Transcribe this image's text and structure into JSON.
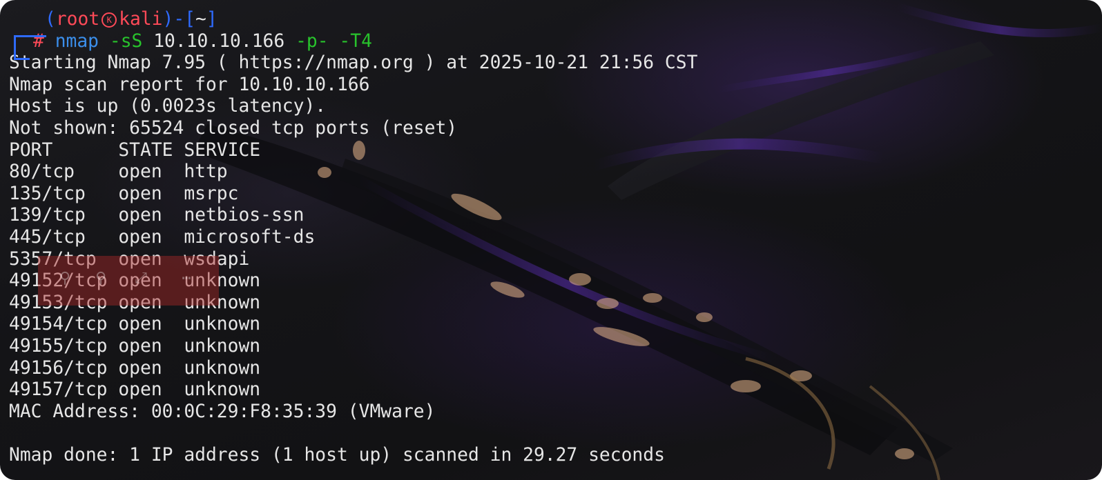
{
  "prompt": {
    "user": "root",
    "logo_icon": "kali-dragon-icon",
    "host": "kali",
    "cwd": "~",
    "hash": "#",
    "command": {
      "program": "nmap",
      "flag1": "-sS",
      "target": "10.10.10.166",
      "flag2": "-p-",
      "flag3": "-T4"
    }
  },
  "output": {
    "starting": "Starting Nmap 7.95 ( https://nmap.org ) at 2025-10-21 21:56 CST",
    "report": "Nmap scan report for 10.10.10.166",
    "host_up": "Host is up (0.0023s latency).",
    "not_shown": "Not shown: 65524 closed tcp ports (reset)",
    "table_header": "PORT      STATE SERVICE",
    "ports": [
      "80/tcp    open  http",
      "135/tcp   open  msrpc",
      "139/tcp   open  netbios-ssn",
      "445/tcp   open  microsoft-ds",
      "5357/tcp  open  wsdapi",
      "49152/tcp open  unknown",
      "49153/tcp open  unknown",
      "49154/tcp open  unknown",
      "49155/tcp open  unknown",
      "49156/tcp open  unknown",
      "49157/tcp open  unknown"
    ],
    "mac": "MAC Address: 00:0C:29:F8:35:39 (VMware)",
    "blank": "",
    "done": "Nmap done: 1 IP address (1 host up) scanned in 29.27 seconds"
  },
  "overlay": {
    "icons": [
      "zoom-icon",
      "zoom-icon",
      "expand-icon",
      "more-icon"
    ]
  },
  "colors": {
    "prompt_frame": "#2f6bff",
    "prompt_user_host": "#ff4a58",
    "command": "#3b8eea",
    "flags": "#28c32c",
    "text": "#e6e6e6",
    "overlay": "#aa2828"
  }
}
